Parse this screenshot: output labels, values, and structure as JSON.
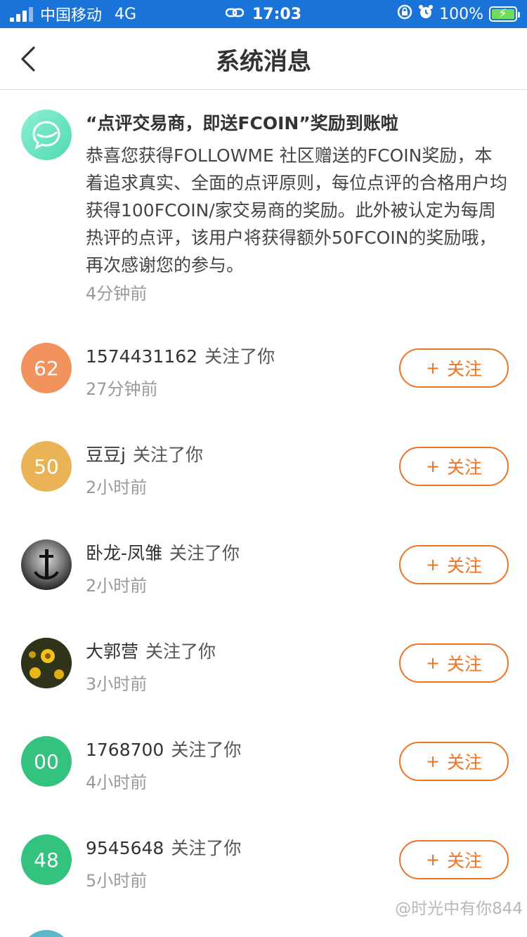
{
  "status_bar": {
    "carrier": "中国移动",
    "network": "4G",
    "time": "17:03",
    "battery": "100%"
  },
  "nav": {
    "title": "系统消息"
  },
  "system_message": {
    "title": "“点评交易商，即送FCOIN”奖励到账啦",
    "body": "恭喜您获得FOLLOWME 社区赠送的FCOIN奖励，本着追求真实、全面的点评原则，每位点评的合格用户均获得100FCOIN/家交易商的奖励。此外被认定为每周热评的点评，该用户将获得额外50FCOIN的奖励哦，再次感谢您的参与。",
    "time": "4分钟前"
  },
  "follow_action_text": "关注了你",
  "follow_button_label": "关注",
  "follows": [
    {
      "name": "1574431162",
      "time": "27分钟前",
      "avatar_text": "62",
      "avatar_color": "#f2935e"
    },
    {
      "name": "豆豆j",
      "time": "2小时前",
      "avatar_text": "50",
      "avatar_color": "#eab356"
    },
    {
      "name": "卧龙-凤雏",
      "time": "2小时前",
      "avatar_text": "",
      "avatar_color": "#3a3a3a"
    },
    {
      "name": "大郭营",
      "time": "3小时前",
      "avatar_text": "",
      "avatar_color": "#3b3a1a"
    },
    {
      "name": "1768700",
      "time": "4小时前",
      "avatar_text": "00",
      "avatar_color": "#34c27f"
    },
    {
      "name": "9545648",
      "time": "5小时前",
      "avatar_text": "48",
      "avatar_color": "#34c27f"
    }
  ],
  "watermark": "@时光中有你844",
  "colors": {
    "status_bar": "#1a73d9",
    "accent": "#ee7324",
    "system_icon": "#4dd9b2"
  }
}
